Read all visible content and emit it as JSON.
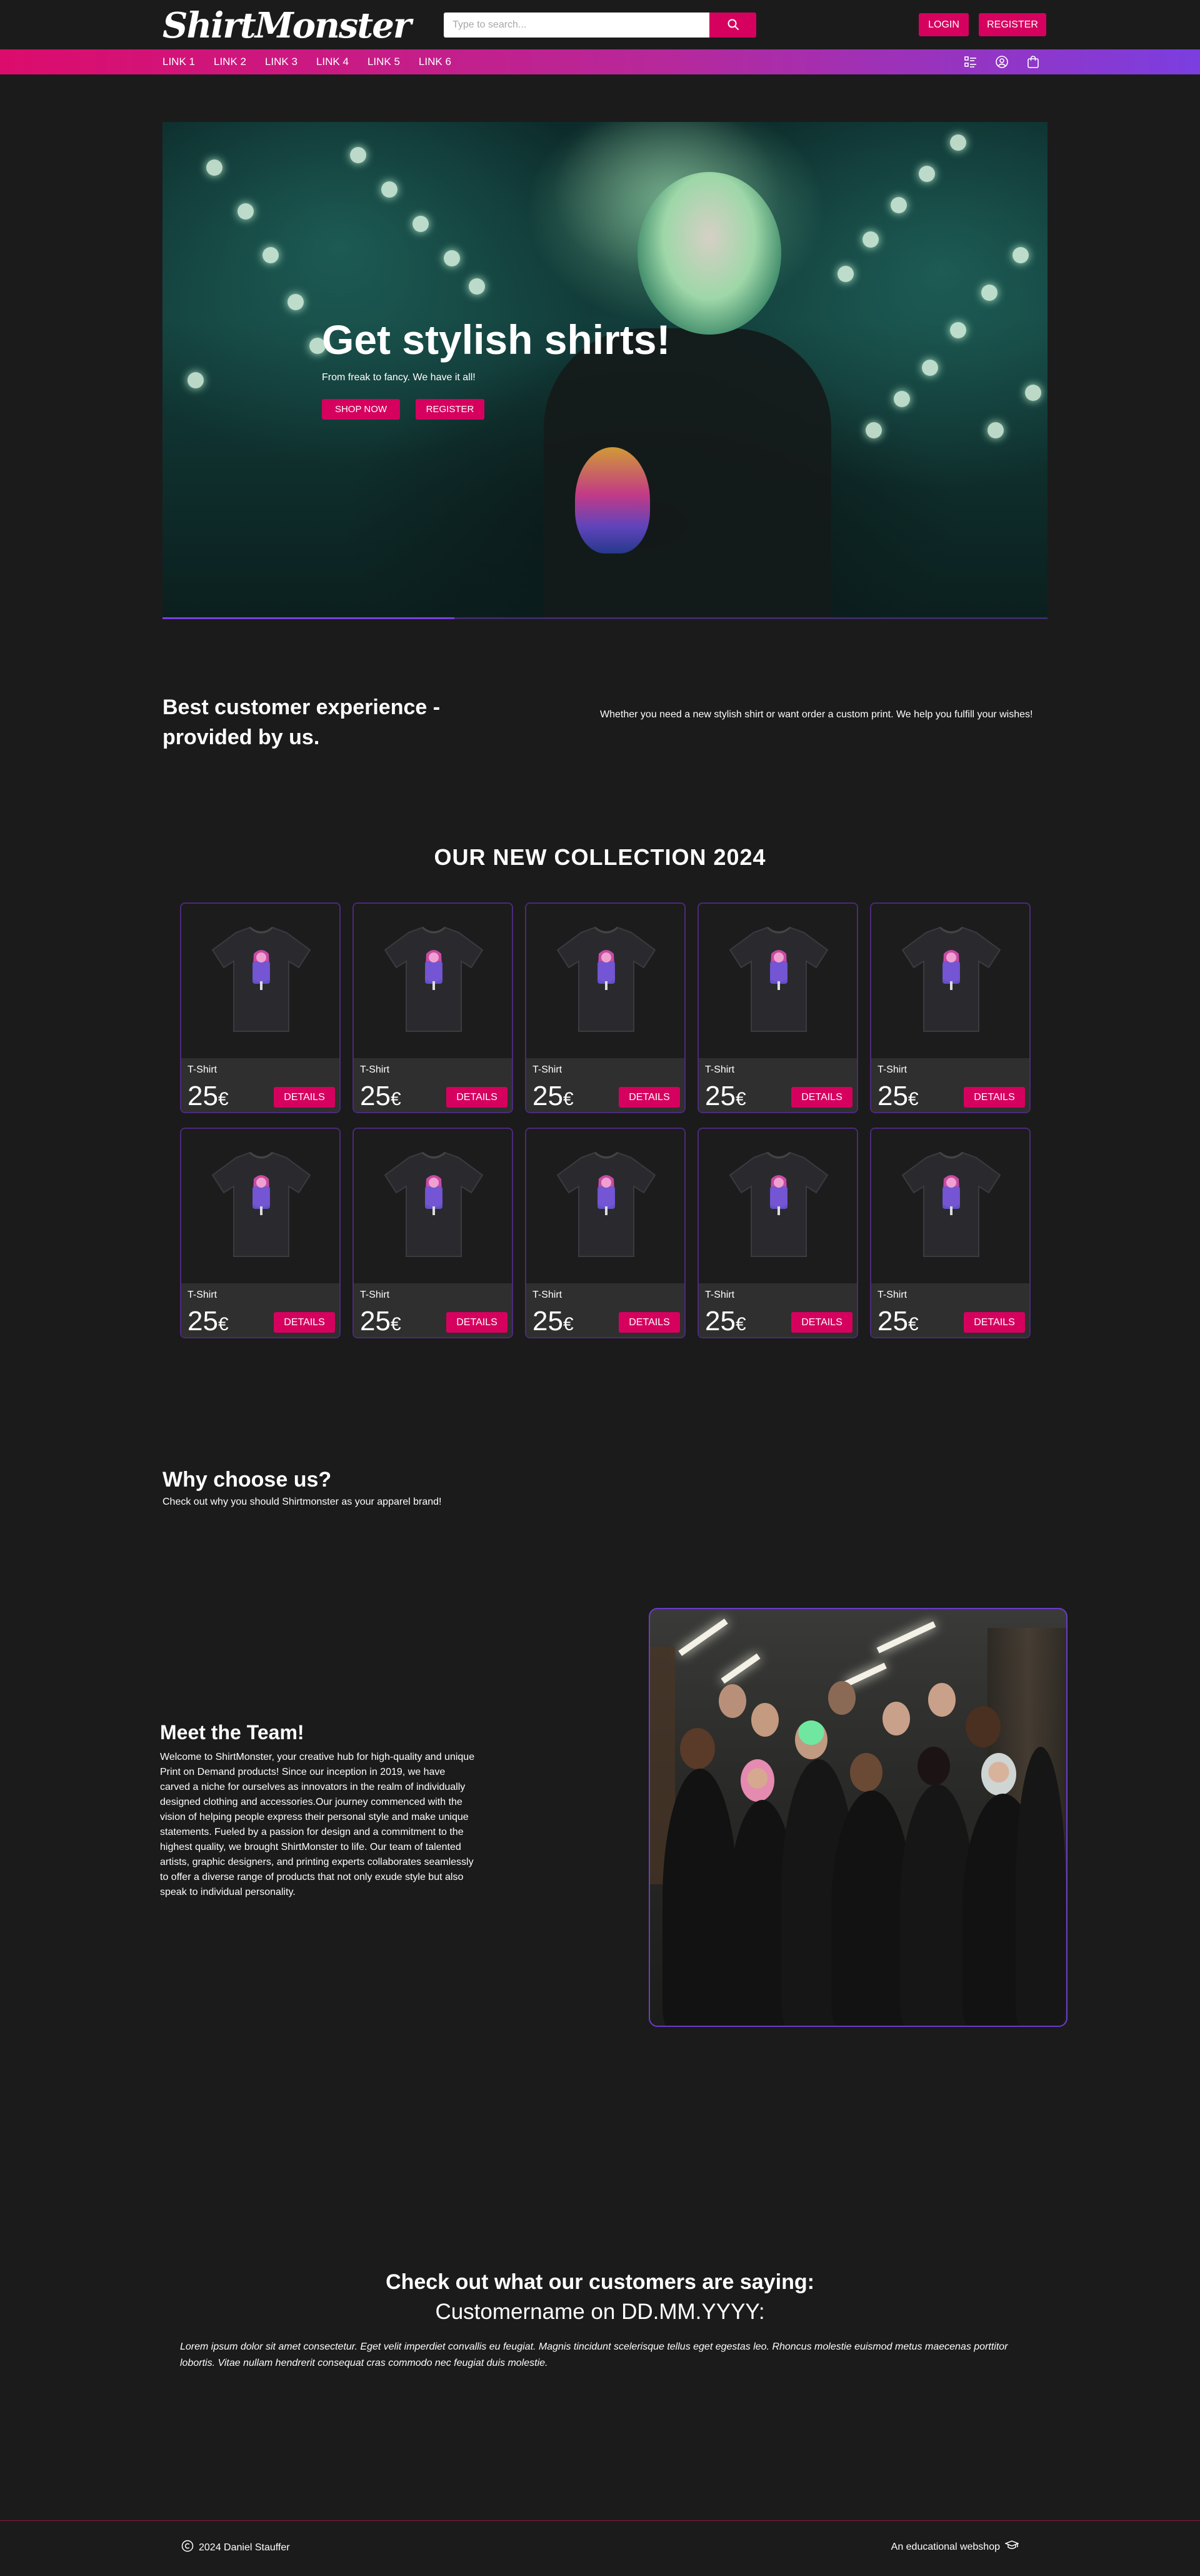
{
  "header": {
    "logo_text": "ShirtMonster",
    "search_placeholder": "Type to search...",
    "login_label": "LOGIN",
    "register_label": "REGISTER"
  },
  "nav": {
    "links": [
      "LINK 1",
      "LINK 2",
      "LINK 3",
      "LINK 4",
      "LINK 5",
      "LINK 6"
    ],
    "icons": [
      "checklist-icon",
      "user-circle-icon",
      "shopping-bag-icon"
    ]
  },
  "hero": {
    "title": "Get stylish shirts!",
    "subtitle": "From freak to fancy. We have it all!",
    "shop_label": "SHOP NOW",
    "register_label": "REGISTER",
    "slide_progress": 0.33
  },
  "experience": {
    "heading": "Best customer experience - provided by us.",
    "text": "Whether you need a new stylish shirt or want order a custom print. We help you fulfill your wishes!"
  },
  "collection": {
    "title": "OUR NEW COLLECTION 2024",
    "products": [
      {
        "name": "T-Shirt",
        "price": "25",
        "currency": "€",
        "button": "DETAILS"
      },
      {
        "name": "T-Shirt",
        "price": "25",
        "currency": "€",
        "button": "DETAILS"
      },
      {
        "name": "T-Shirt",
        "price": "25",
        "currency": "€",
        "button": "DETAILS"
      },
      {
        "name": "T-Shirt",
        "price": "25",
        "currency": "€",
        "button": "DETAILS"
      },
      {
        "name": "T-Shirt",
        "price": "25",
        "currency": "€",
        "button": "DETAILS"
      },
      {
        "name": "T-Shirt",
        "price": "25",
        "currency": "€",
        "button": "DETAILS"
      },
      {
        "name": "T-Shirt",
        "price": "25",
        "currency": "€",
        "button": "DETAILS"
      },
      {
        "name": "T-Shirt",
        "price": "25",
        "currency": "€",
        "button": "DETAILS"
      },
      {
        "name": "T-Shirt",
        "price": "25",
        "currency": "€",
        "button": "DETAILS"
      },
      {
        "name": "T-Shirt",
        "price": "25",
        "currency": "€",
        "button": "DETAILS"
      }
    ]
  },
  "why": {
    "title": "Why choose us?",
    "subtitle": "Check out why you should Shirtmonster as your apparel brand!"
  },
  "team": {
    "title": "Meet the Team!",
    "text": "Welcome to ShirtMonster, your creative hub for high-quality and unique Print on Demand products! Since our inception in 2019, we have carved a niche for ourselves as innovators in the realm of individually designed clothing and accessories.Our journey commenced with the vision of helping people express their personal style and make unique statements. Fueled by a passion for design and a commitment to the highest quality, we brought ShirtMonster to life. Our team of talented artists, graphic designers, and printing experts collaborates seamlessly to offer a diverse range of products that not only exude style but also speak to individual personality."
  },
  "testimonials": {
    "title": "Check out what our customers are saying:",
    "customer": "Customername on DD.MM.YYYY:",
    "quote": "Lorem ipsum dolor sit amet consectetur. Eget velit imperdiet convallis eu feugiat. Magnis tincidunt scelerisque tellus eget egestas leo. Rhoncus molestie euismod metus maecenas porttitor lobortis. Vitae nullam hendrerit consequat cras commodo nec feugiat duis molestie."
  },
  "footer": {
    "copyright": "2024 Daniel Stauffer",
    "tagline": "An educational webshop"
  },
  "colors": {
    "accent": "#d6005f",
    "purple": "#7b3ee0",
    "background": "#1b1b1b"
  }
}
